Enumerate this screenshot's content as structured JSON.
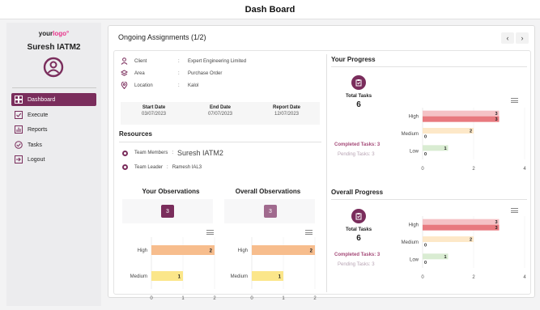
{
  "header": {
    "title": "Dash Board"
  },
  "brand": {
    "logo_prefix": "your",
    "logo_accent": "logo",
    "logo_mark": "°"
  },
  "user": {
    "name": "Suresh IATM2"
  },
  "sidebar": {
    "items": [
      {
        "label": "Dashboard",
        "icon": "dashboard-icon",
        "active": true
      },
      {
        "label": "Execute",
        "icon": "checkbox-icon"
      },
      {
        "label": "Reports",
        "icon": "bar-chart-icon"
      },
      {
        "label": "Tasks",
        "icon": "check-circle-icon"
      },
      {
        "label": "Logout",
        "icon": "logout-icon"
      }
    ]
  },
  "main": {
    "title": "Ongoing Assignments (1/2)",
    "prev": "‹",
    "next": "›"
  },
  "assignment": {
    "client_label": "Client",
    "client": "Expert Engineering Limited",
    "area_label": "Area",
    "area": "Purchase Order",
    "location_label": "Location",
    "location": "Kalol",
    "colon": ":",
    "start_label": "Start Date",
    "start": "03/07/2023",
    "end_label": "End Date",
    "end": "07/07/2023",
    "report_label": "Report Date",
    "report": "12/07/2023"
  },
  "resources": {
    "title": "Resources",
    "members_label": "Team Members",
    "members": "Suresh IATM2",
    "leader_label": "Team Leader",
    "leader": "Ramesh IAL3",
    "colon": ":"
  },
  "observations": {
    "your_title": "Your Observations",
    "your_count": "3",
    "overall_title": "Overall Observations",
    "overall_count": "3"
  },
  "progress": {
    "your_title": "Your Progress",
    "overall_title": "Overall Progress",
    "total_label": "Total Tasks",
    "total_value": "6",
    "completed": "Completed Tasks: 3",
    "pending": "Pending Tasks: 3"
  },
  "colors": {
    "brand": "#7a2d5c",
    "accent": "#e7338a"
  },
  "chart_data": [
    {
      "type": "bar",
      "orientation": "horizontal",
      "categories": [
        "High",
        "Medium"
      ],
      "values": [
        2,
        1
      ],
      "xlim": [
        0,
        2
      ],
      "xticks": [
        0,
        1,
        2
      ],
      "colors": [
        "#f7bd8d",
        "#fbe68a"
      ]
    },
    {
      "type": "bar",
      "orientation": "horizontal",
      "categories": [
        "High",
        "Medium"
      ],
      "values": [
        2,
        1
      ],
      "xlim": [
        0,
        2
      ],
      "xticks": [
        0,
        1,
        2
      ],
      "colors": [
        "#f7bd8d",
        "#fbe68a"
      ]
    },
    {
      "type": "bar",
      "orientation": "horizontal",
      "categories": [
        "High",
        "Medium",
        "Low"
      ],
      "series": [
        {
          "values": [
            3,
            2,
            1
          ]
        },
        {
          "values": [
            3,
            0,
            0
          ]
        }
      ],
      "xlim": [
        0,
        4
      ],
      "xticks": [
        0,
        2,
        4
      ],
      "colors": [
        [
          "#f5c2c6",
          "#e8797f"
        ],
        [
          "#fde8c8",
          "#fbd9a8"
        ],
        [
          "#d9ecd2",
          "#c3e0b7"
        ]
      ]
    },
    {
      "type": "bar",
      "orientation": "horizontal",
      "categories": [
        "High",
        "Medium",
        "Low"
      ],
      "series": [
        {
          "values": [
            3,
            2,
            1
          ]
        },
        {
          "values": [
            3,
            0,
            0
          ]
        }
      ],
      "xlim": [
        0,
        4
      ],
      "xticks": [
        0,
        2,
        4
      ],
      "colors": [
        [
          "#f5c2c6",
          "#e8797f"
        ],
        [
          "#fde8c8",
          "#fbd9a8"
        ],
        [
          "#d9ecd2",
          "#c3e0b7"
        ]
      ]
    }
  ]
}
